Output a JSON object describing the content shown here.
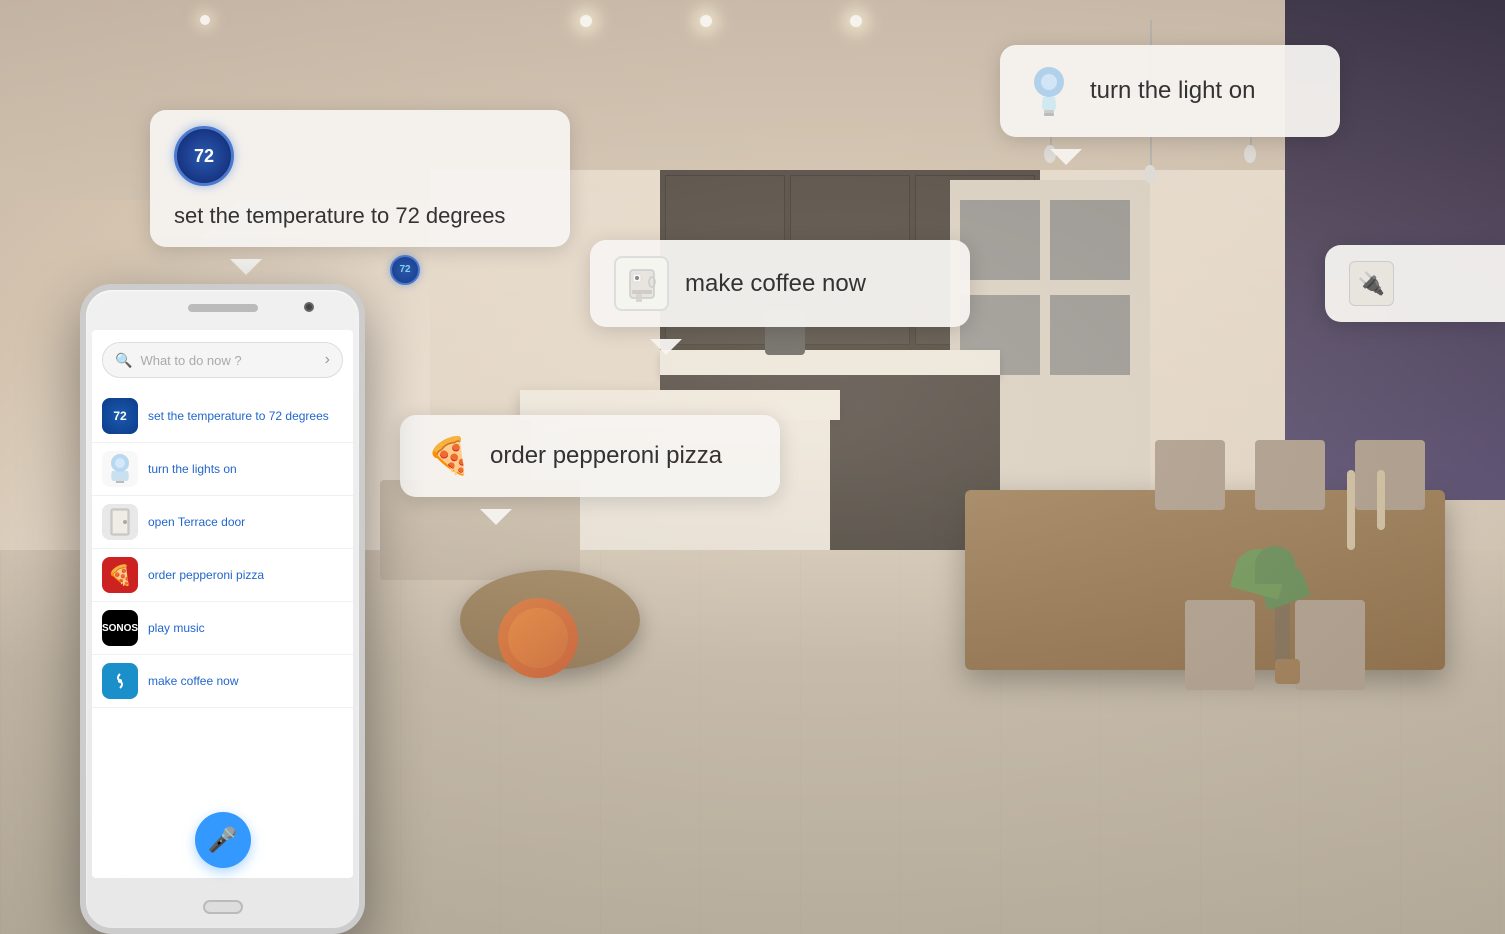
{
  "background": {
    "description": "Modern smart home living room and kitchen"
  },
  "bubbles": {
    "temperature": {
      "text": "set the temperature to 72 degrees",
      "icon": "72",
      "icon_label": "nest-thermostat"
    },
    "light": {
      "text": "turn the light on",
      "icon": "💡",
      "icon_label": "smart-bulb"
    },
    "coffee": {
      "text": "make coffee now",
      "icon": "☕",
      "icon_label": "coffee-maker"
    },
    "pizza": {
      "text": "order pepperoni pizza",
      "icon": "🍕",
      "icon_label": "pizza"
    }
  },
  "phone": {
    "search_placeholder": "What to do now ?",
    "items": [
      {
        "label": "set the temperature to 72 degrees",
        "icon_type": "nest"
      },
      {
        "label": "turn the lights on",
        "icon_type": "hue"
      },
      {
        "label": "open Terrace door",
        "icon_type": "door"
      },
      {
        "label": "order pepperoni pizza",
        "icon_type": "pizza"
      },
      {
        "label": "play music",
        "icon_type": "sonos"
      },
      {
        "label": "make coffee now",
        "icon_type": "smartthings"
      }
    ]
  }
}
